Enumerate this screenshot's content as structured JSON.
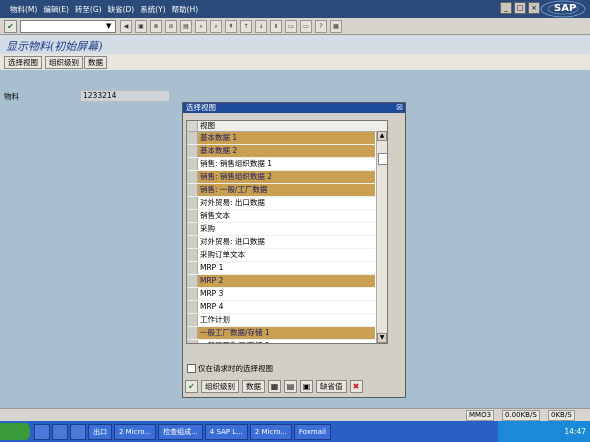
{
  "menu": [
    "物料(M)",
    "编辑(E)",
    "转至(G)",
    "缺省(D)",
    "系统(Y)",
    "帮助(H)"
  ],
  "logo_text": "SAP",
  "window_buttons": [
    "_",
    "□",
    "×"
  ],
  "screen_title": "显示物料(初始屏幕)",
  "app_toolbar": [
    "选择视图",
    "组织级别",
    "数据"
  ],
  "material": {
    "label": "物料",
    "value": "1233214"
  },
  "dialog": {
    "title": "选择视图",
    "column_header": "视图",
    "rows": [
      {
        "label": "基本数据 1",
        "selected": true
      },
      {
        "label": "基本数据 2",
        "selected": true
      },
      {
        "label": "销售: 销售组织数据 1",
        "selected": false
      },
      {
        "label": "销售: 销售组织数据 2",
        "selected": true
      },
      {
        "label": "销售: 一般/工厂数据",
        "selected": true
      },
      {
        "label": "对外贸易: 出口数据",
        "selected": false
      },
      {
        "label": "销售文本",
        "selected": false
      },
      {
        "label": "采购",
        "selected": false
      },
      {
        "label": "对外贸易: 进口数据",
        "selected": false
      },
      {
        "label": "采购订单文本",
        "selected": false
      },
      {
        "label": "MRP 1",
        "selected": false
      },
      {
        "label": "MRP 2",
        "selected": true
      },
      {
        "label": "MRP 3",
        "selected": false
      },
      {
        "label": "MRP 4",
        "selected": false
      },
      {
        "label": "工作计划",
        "selected": false
      },
      {
        "label": "一般工厂数据/存储 1",
        "selected": true
      },
      {
        "label": "一般工厂数据/存储 2",
        "selected": false
      }
    ],
    "checkbox_label": "仅在请求时的选择视图",
    "buttons": {
      "org_levels": "组织级别",
      "data": "数据",
      "defaults": "缺省值"
    }
  },
  "status": {
    "system": "MMO3",
    "upload": "0.00KB/S",
    "download": "0KB/S"
  },
  "taskbar": {
    "tasks": [
      "出口",
      "2 Micro...",
      "检查组成...",
      "4 SAP L...",
      "2 Micro...",
      "Foxmail"
    ],
    "clock": "14:47"
  }
}
